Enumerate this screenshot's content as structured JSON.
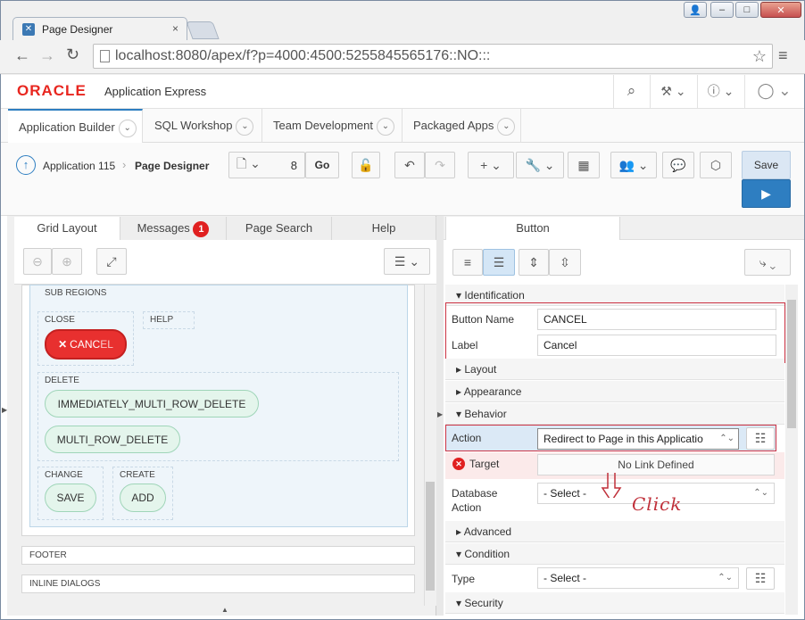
{
  "browser": {
    "tab_title": "Page Designer",
    "url": "localhost:8080/apex/f?p=4000:4500:5255845565176::NO:::"
  },
  "brand": {
    "logo": "ORACLE",
    "product": "Application Express"
  },
  "main_tabs": [
    "Application Builder",
    "SQL Workshop",
    "Team Development",
    "Packaged Apps"
  ],
  "breadcrumb": {
    "app": "Application 115",
    "page": "Page Designer"
  },
  "toolbar": {
    "page_number": "8",
    "go_label": "Go",
    "save_label": "Save"
  },
  "left_tabs": {
    "grid_layout": "Grid Layout",
    "messages": "Messages",
    "messages_count": "1",
    "page_search": "Page Search",
    "help": "Help"
  },
  "grid": {
    "sub_regions": "SUB REGIONS",
    "close": "CLOSE",
    "help": "HELP",
    "cancel_btn_pre": "CANC",
    "cancel_btn_post": "EL",
    "delete": "DELETE",
    "imm_delete": "IMMEDIATELY_MULTI_ROW_DELETE",
    "multi_delete": "MULTI_ROW_DELETE",
    "change": "CHANGE",
    "create": "CREATE",
    "save": "SAVE",
    "add": "ADD",
    "footer": "FOOTER",
    "inline_dialogs": "INLINE DIALOGS"
  },
  "props": {
    "tab": "Button",
    "identification": "Identification",
    "button_name_label": "Button Name",
    "button_name_value": "CANCEL",
    "label_label": "Label",
    "label_value": "Cancel",
    "layout": "Layout",
    "appearance": "Appearance",
    "behavior": "Behavior",
    "action_label": "Action",
    "action_value": "Redirect to Page in this Applicatio",
    "target_label": "Target",
    "target_value": "No Link Defined",
    "db_action_label_1": "Database",
    "db_action_label_2": "Action",
    "db_action_value": "- Select -",
    "advanced": "Advanced",
    "condition": "Condition",
    "type_label": "Type",
    "type_value": "- Select -",
    "security": "Security"
  },
  "annotation": {
    "text": "Click"
  },
  "colors": {
    "accent": "#2e7ec1",
    "danger": "#e03030",
    "annotation": "#c0303a"
  }
}
